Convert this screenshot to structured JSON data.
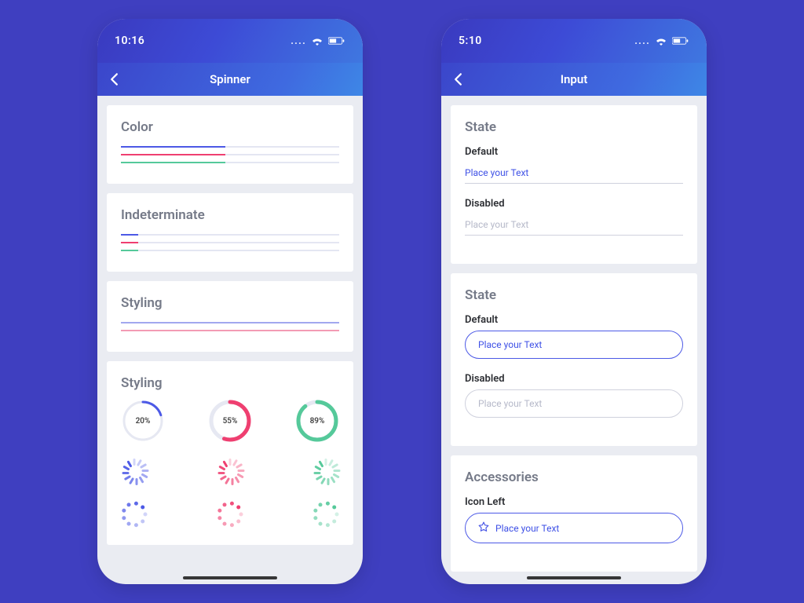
{
  "colors": {
    "blue": "#4c59e6",
    "pink": "#ef3f70",
    "green": "#55c99a"
  },
  "left": {
    "time": "10:16",
    "title": "Spinner",
    "sections": {
      "color": {
        "heading": "Color",
        "bars": [
          {
            "color": "blue",
            "pct": 48
          },
          {
            "color": "pink",
            "pct": 48
          },
          {
            "color": "green",
            "pct": 48
          }
        ]
      },
      "indeterminate": {
        "heading": "Indeterminate",
        "bars": [
          {
            "color": "blue",
            "pct": 8
          },
          {
            "color": "pink",
            "pct": 8
          },
          {
            "color": "green",
            "pct": 8
          }
        ]
      },
      "styling_bars": {
        "heading": "Styling",
        "bars": [
          {
            "color": "blue",
            "pct": 100
          },
          {
            "color": "pink",
            "pct": 100
          }
        ]
      },
      "styling_spinners": {
        "heading": "Styling",
        "rings": [
          {
            "color": "blue",
            "pct": 20,
            "thick": 3
          },
          {
            "color": "pink",
            "pct": 55,
            "thick": 5
          },
          {
            "color": "green",
            "pct": 89,
            "thick": 5
          }
        ]
      }
    }
  },
  "right": {
    "time": "5:10",
    "title": "Input",
    "sections": {
      "state_underline": {
        "heading": "State",
        "default_label": "Default",
        "default_value": "Place your Text",
        "disabled_label": "Disabled",
        "disabled_value": "Place your Text"
      },
      "state_pill": {
        "heading": "State",
        "default_label": "Default",
        "default_value": "Place your Text",
        "disabled_label": "Disabled",
        "disabled_value": "Place your Text"
      },
      "accessories": {
        "heading": "Accessories",
        "icon_left_label": "Icon Left",
        "icon_left_value": "Place your Text"
      }
    }
  }
}
